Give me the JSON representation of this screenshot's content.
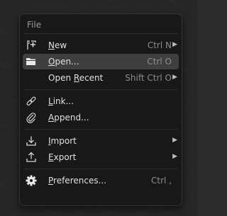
{
  "menu": {
    "title": "File",
    "items": [
      {
        "key": "new",
        "icon": "new-file-icon",
        "label_ul": "N",
        "label_rest": "ew",
        "shortcut": "Ctrl N",
        "submenu": true
      },
      {
        "key": "open",
        "icon": "folder-open-icon",
        "label_ul": "O",
        "label_rest": "pen...",
        "shortcut": "Ctrl O",
        "submenu": false
      },
      {
        "key": "open-recent",
        "icon": "",
        "label_pre": "Open ",
        "label_ul": "R",
        "label_rest": "ecent",
        "shortcut": "Shift Ctrl O",
        "submenu": true
      },
      {
        "key": "link",
        "icon": "link-icon",
        "label_ul": "L",
        "label_rest": "ink...",
        "shortcut": "",
        "submenu": false
      },
      {
        "key": "append",
        "icon": "append-icon",
        "label_ul": "A",
        "label_rest": "ppend...",
        "shortcut": "",
        "submenu": false
      },
      {
        "key": "import",
        "icon": "import-icon",
        "label_ul": "I",
        "label_rest": "mport",
        "shortcut": "",
        "submenu": true
      },
      {
        "key": "export",
        "icon": "export-icon",
        "label_ul": "E",
        "label_rest": "xport",
        "shortcut": "",
        "submenu": true
      },
      {
        "key": "preferences",
        "icon": "gear-icon",
        "label_ul": "P",
        "label_rest": "references...",
        "shortcut": "Ctrl ,",
        "submenu": false
      }
    ]
  },
  "arrow_glyph": "▶",
  "colors": {
    "menu_bg": "#181818",
    "highlight": "#3f3f3f",
    "text": "#e0e0e0",
    "shortcut_text": "#8d8d8d"
  }
}
